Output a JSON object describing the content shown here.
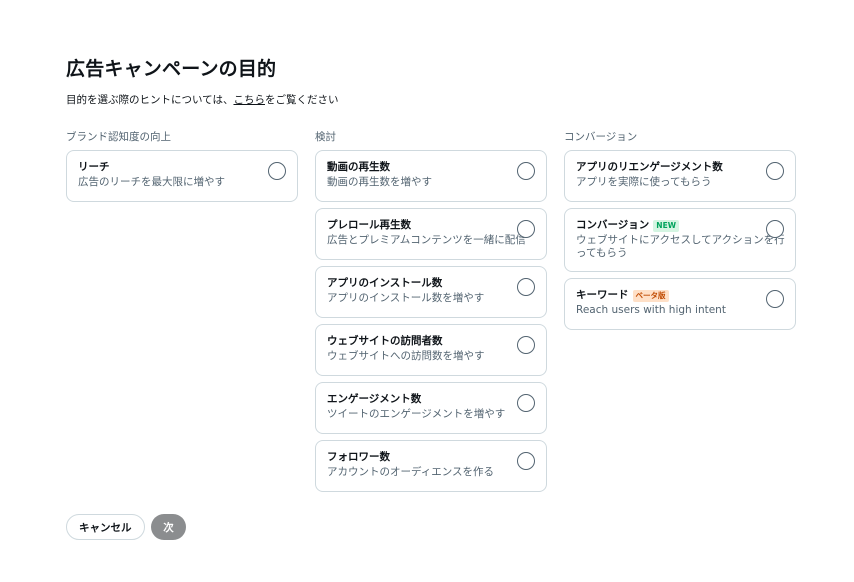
{
  "title": "広告キャンペーンの目的",
  "hint": {
    "prefix": "目的を選ぶ際のヒントについては、",
    "link": "こちら",
    "suffix": "をご覧ください"
  },
  "columns": [
    {
      "header": "ブランド認知度の向上",
      "cards": [
        {
          "title": "リーチ",
          "desc": "広告のリーチを最大限に増やす"
        }
      ]
    },
    {
      "header": "検討",
      "cards": [
        {
          "title": "動画の再生数",
          "desc": "動画の再生数を増やす"
        },
        {
          "title": "プレロール再生数",
          "desc": "広告とプレミアムコンテンツを一緒に配信"
        },
        {
          "title": "アプリのインストール数",
          "desc": "アプリのインストール数を増やす"
        },
        {
          "title": "ウェブサイトの訪問者数",
          "desc": "ウェブサイトへの訪問数を増やす"
        },
        {
          "title": "エンゲージメント数",
          "desc": "ツイートのエンゲージメントを増やす"
        },
        {
          "title": "フォロワー数",
          "desc": "アカウントのオーディエンスを作る"
        }
      ]
    },
    {
      "header": "コンバージョン",
      "cards": [
        {
          "title": "アプリのリエンゲージメント数",
          "desc": "アプリを実際に使ってもらう"
        },
        {
          "title": "コンバージョン",
          "badge": "NEW",
          "desc": "ウェブサイトにアクセスしてアクションを行ってもらう"
        },
        {
          "title": "キーワード",
          "badge": "ベータ版",
          "desc": "Reach users with high intent"
        }
      ]
    }
  ],
  "buttons": {
    "cancel": "キャンセル",
    "next": "次"
  },
  "colors": {
    "border": "#cfd9de",
    "secondary_text": "#536471",
    "next_disabled": "#8b8d8f",
    "badge_new": "#00a35c",
    "badge_beta": "#c04a00"
  }
}
